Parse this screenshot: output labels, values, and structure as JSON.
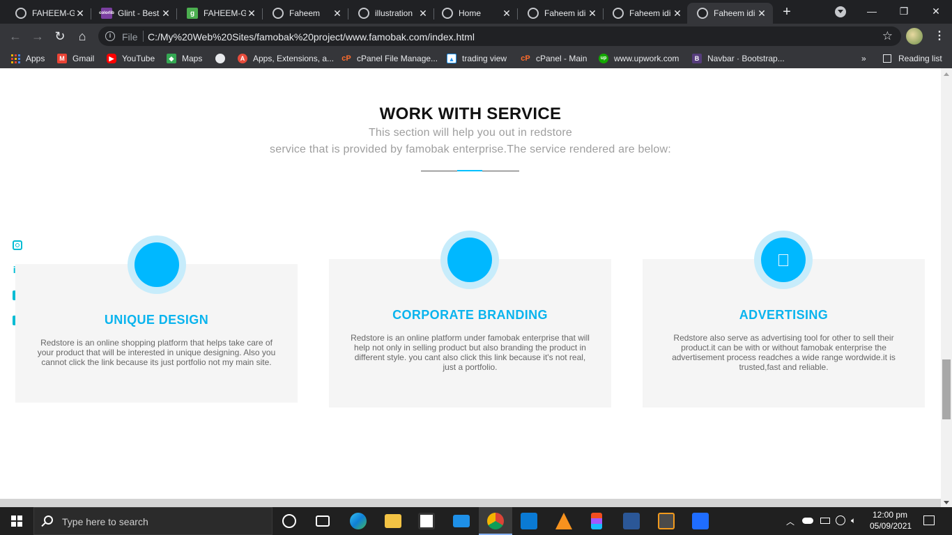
{
  "browser": {
    "tabs": [
      {
        "title": "FAHEEM-G",
        "icon": "globe-icon",
        "active": false
      },
      {
        "title": "Glint - Best",
        "icon": "colorlib-icon",
        "active": false
      },
      {
        "title": "FAHEEM-G",
        "icon": "g-icon",
        "active": false
      },
      {
        "title": "Faheem",
        "icon": "globe-icon",
        "active": false
      },
      {
        "title": "illustration",
        "icon": "globe-icon",
        "active": false
      },
      {
        "title": "Home",
        "icon": "globe-icon",
        "active": false
      },
      {
        "title": "Faheem idi",
        "icon": "globe-icon",
        "active": false
      },
      {
        "title": "Faheem idi",
        "icon": "globe-icon",
        "active": false
      },
      {
        "title": "Faheem idi",
        "icon": "globe-icon",
        "active": true
      }
    ],
    "address": {
      "scheme": "File",
      "url": "C:/My%20Web%20Sites/famobak%20project/www.famobak.com/index.html"
    },
    "bookmarks": [
      {
        "label": "Apps",
        "icon": "apps-grid-icon",
        "color": "#f4b400"
      },
      {
        "label": "Gmail",
        "icon": "gmail-icon",
        "color": "#ea4335"
      },
      {
        "label": "YouTube",
        "icon": "youtube-icon",
        "color": "#ff0000"
      },
      {
        "label": "Maps",
        "icon": "maps-icon",
        "color": "#34a853"
      },
      {
        "label": "",
        "icon": "globe-icon",
        "color": "#e8eaed"
      },
      {
        "label": "Apps, Extensions, a...",
        "icon": "extensions-icon",
        "color": "#e74c3c"
      },
      {
        "label": "cPanel File Manage...",
        "icon": "cpanel-icon",
        "color": "#ff6c2c"
      },
      {
        "label": "trading view",
        "icon": "tradingview-icon",
        "color": "#2196f3"
      },
      {
        "label": "cPanel - Main",
        "icon": "cpanel-icon",
        "color": "#ff6c2c"
      },
      {
        "label": "www.upwork.com",
        "icon": "upwork-icon",
        "color": "#14a800"
      },
      {
        "label": "Navbar · Bootstrap...",
        "icon": "bootstrap-icon",
        "color": "#563d7c"
      }
    ],
    "overflow": "»",
    "reading_list": "Reading list"
  },
  "page": {
    "title": "WORK WITH SERVICE",
    "subtitle_line1": "This section will help you out in redstore",
    "subtitle_line2": "service that is provided by famobak enterprise.The service rendered are below:",
    "social": [
      "instagram-icon",
      "linkedin-icon",
      "facebook-icon",
      "twitter-icon"
    ],
    "accent_color": "#00b8ff",
    "services": [
      {
        "title": "UNIQUE DESIGN",
        "text": "Redstore is an online shopping platform that helps take care of your product that will be interested in unique designing. Also you cannot click the link because its just portfolio not my main site."
      },
      {
        "title": "CORPORATE BRANDING",
        "text": "Redstore is an online platform under famobak enterprise that will help not only in selling product but also branding the product in different style. you cant also click this link because it's not real, just a portfolio."
      },
      {
        "title": "ADVERTISING",
        "text": "Redstore also serve as advertising tool for other to sell their product.it can be with or without famobak enterprise the advertisement process readches a wide range wordwide.it is trusted,fast and reliable."
      }
    ]
  },
  "taskbar": {
    "search_placeholder": "Type here to search",
    "time": "12:00 pm",
    "date": "05/09/2021"
  }
}
